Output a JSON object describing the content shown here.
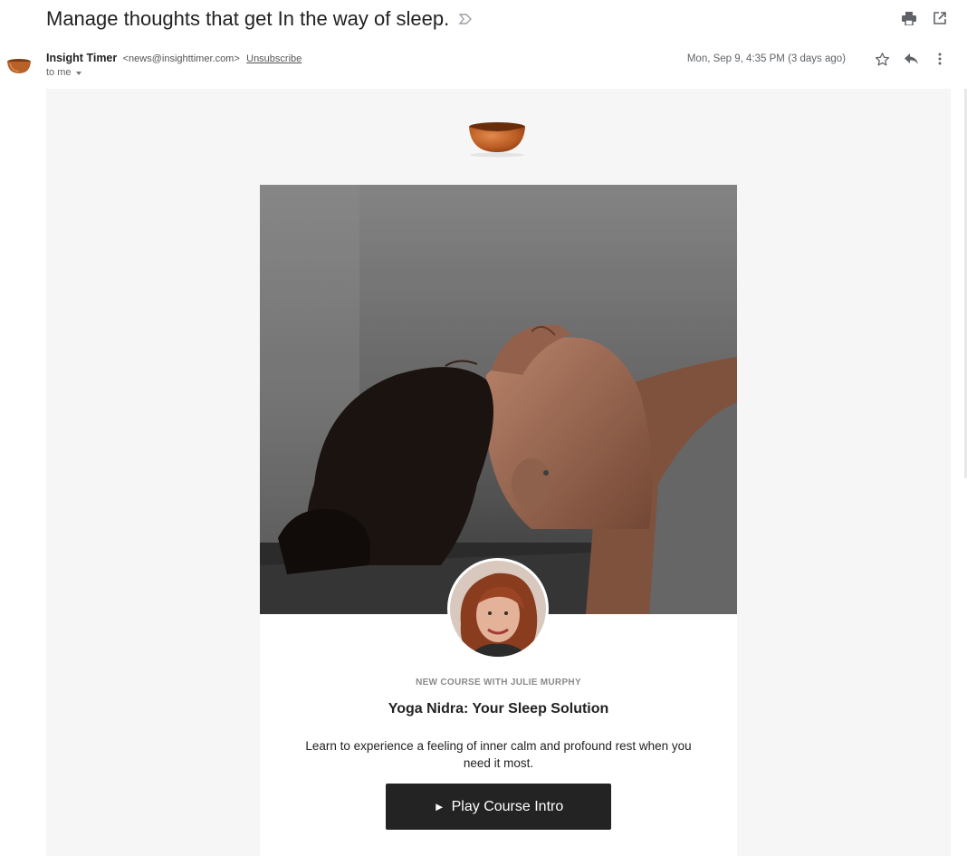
{
  "email": {
    "subject": "Manage thoughts that get In the way of sleep.",
    "sender_name": "Insight Timer",
    "sender_email": "<news@insighttimer.com>",
    "unsubscribe_label": "Unsubscribe",
    "to_label": "to me",
    "date": "Mon, Sep 9, 4:35 PM (3 days ago)"
  },
  "icons": {
    "label": "label-arrow-icon",
    "print": "print-icon",
    "popout": "open-in-new-window-icon",
    "star": "star-icon",
    "reply": "reply-icon",
    "more": "more-vertical-icon",
    "avatar": "singing-bowl-avatar",
    "logo": "singing-bowl-logo"
  },
  "body": {
    "eyebrow": "NEW COURSE WITH JULIE MURPHY",
    "course_title": "Yoga Nidra: Your Sleep Solution",
    "description": "Learn to experience a feeling of inner calm and profound rest when you need it most.",
    "button_label": "Play Course Intro"
  },
  "colors": {
    "bowl": "#b8622a",
    "button_bg": "#232323",
    "body_bg": "#f6f6f6"
  }
}
